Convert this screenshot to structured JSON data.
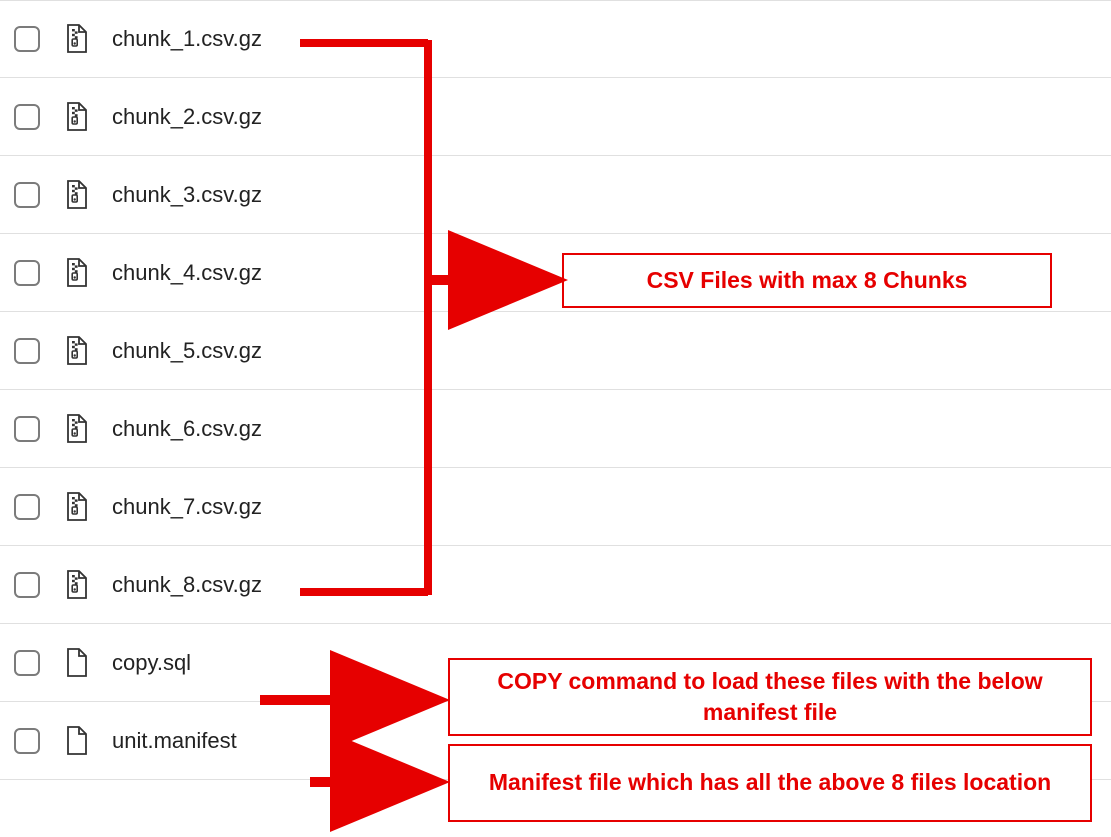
{
  "files": [
    {
      "name": "chunk_1.csv.gz",
      "iconType": "zip"
    },
    {
      "name": "chunk_2.csv.gz",
      "iconType": "zip"
    },
    {
      "name": "chunk_3.csv.gz",
      "iconType": "zip"
    },
    {
      "name": "chunk_4.csv.gz",
      "iconType": "zip"
    },
    {
      "name": "chunk_5.csv.gz",
      "iconType": "zip"
    },
    {
      "name": "chunk_6.csv.gz",
      "iconType": "zip"
    },
    {
      "name": "chunk_7.csv.gz",
      "iconType": "zip"
    },
    {
      "name": "chunk_8.csv.gz",
      "iconType": "zip"
    },
    {
      "name": "copy.sql",
      "iconType": "file"
    },
    {
      "name": "unit.manifest",
      "iconType": "file"
    }
  ],
  "annotations": {
    "csvChunks": "CSV Files with max 8 Chunks",
    "copyCmd": "COPY command to load these files with the below manifest file",
    "manifest": "Manifest file which has all the above 8 files location"
  },
  "colors": {
    "annotationRed": "#e60000"
  }
}
